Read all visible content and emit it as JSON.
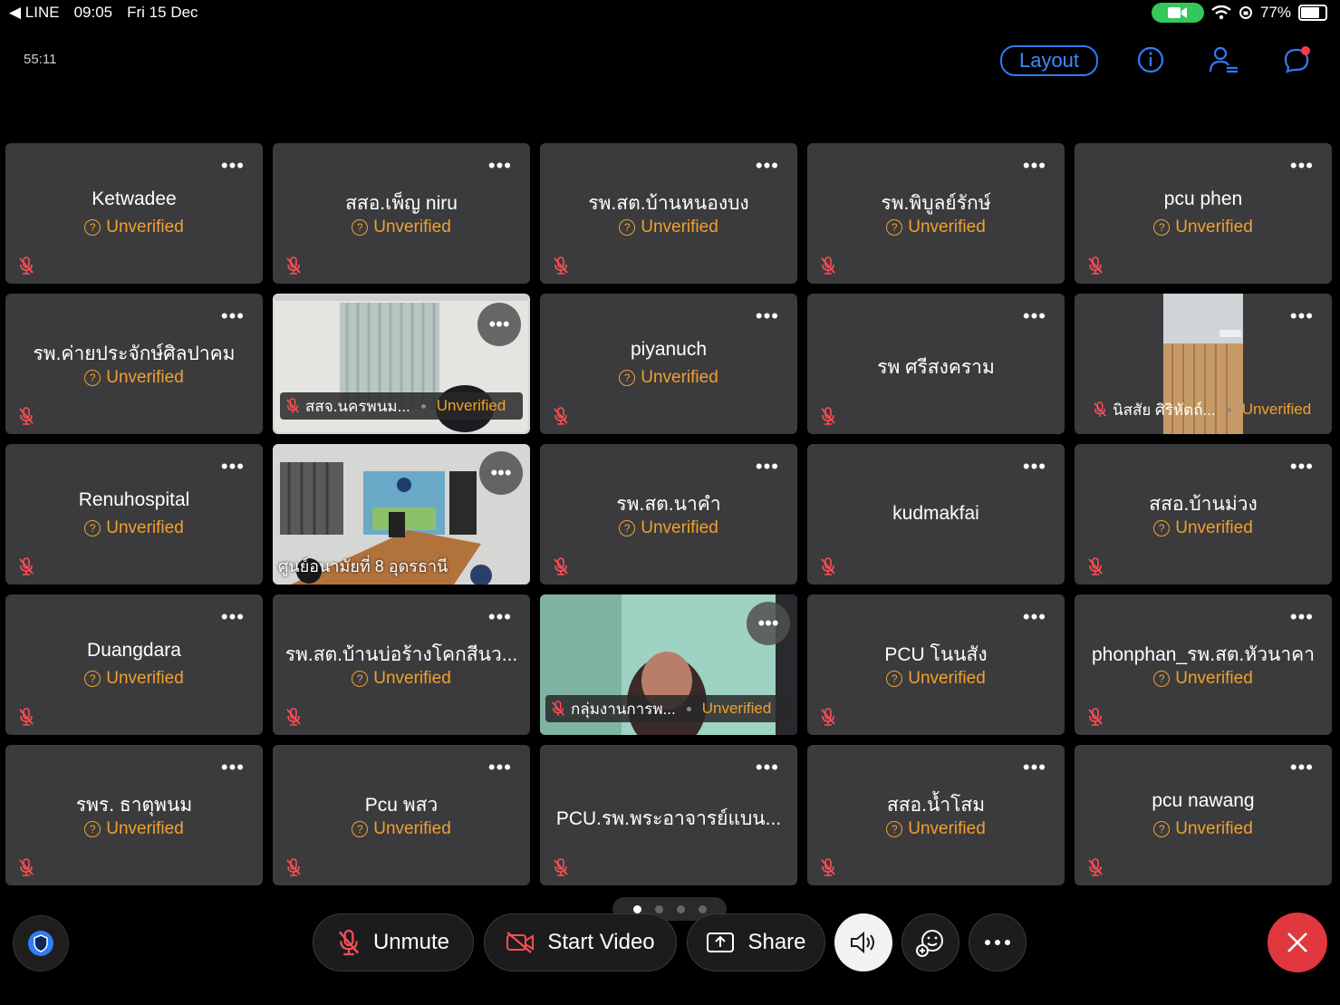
{
  "statusbar": {
    "back_app": "◀ LINE",
    "time": "09:05",
    "date": "Fri 15 Dec",
    "battery": "77%"
  },
  "header": {
    "timer": "55:11",
    "layout_label": "Layout"
  },
  "tiles": [
    {
      "name": "Ketwadee",
      "status": "Unverified"
    },
    {
      "name": "สสอ.เพ็ญ niru",
      "status": "Unverified"
    },
    {
      "name": "รพ.สต.บ้านหนองบง",
      "status": "Unverified"
    },
    {
      "name": "รพ.พิบูลย์รักษ์",
      "status": "Unverified"
    },
    {
      "name": "pcu phen",
      "status": "Unverified"
    },
    {
      "name": "รพ.ค่ายประจักษ์ศิลปาคม",
      "status": "Unverified"
    },
    {
      "name": "สสจ.นครพนม...",
      "status": "Unverified"
    },
    {
      "name": "piyanuch",
      "status": "Unverified"
    },
    {
      "name": "รพ ศรีสงคราม",
      "status": ""
    },
    {
      "name": "นิสสัย  ศิริหัตถ์...",
      "status": "Unverified"
    },
    {
      "name": "Renuhospital",
      "status": "Unverified"
    },
    {
      "name": "ศูนย์อนามัยที่ 8 อุดรธานี",
      "status": ""
    },
    {
      "name": "รพ.สต.นาคำ",
      "status": "Unverified"
    },
    {
      "name": "kudmakfai",
      "status": ""
    },
    {
      "name": "สสอ.บ้านม่วง",
      "status": "Unverified"
    },
    {
      "name": "Duangdara",
      "status": "Unverified"
    },
    {
      "name": "รพ.สต.บ้านบ่อร้างโคกสีนว...",
      "status": "Unverified"
    },
    {
      "name": "กลุ่มงานการพ...",
      "status": "Unverified"
    },
    {
      "name": "PCU โนนสัง",
      "status": "Unverified"
    },
    {
      "name": "phonphan_รพ.สต.หัวนาคา",
      "status": "Unverified"
    },
    {
      "name": "รพร. ธาตุพนม",
      "status": "Unverified"
    },
    {
      "name": "Pcu พสว",
      "status": "Unverified"
    },
    {
      "name": "PCU.รพ.พระอาจารย์แบน...",
      "status": ""
    },
    {
      "name": "สสอ.น้ำโสม",
      "status": "Unverified"
    },
    {
      "name": "pcu nawang",
      "status": "Unverified"
    }
  ],
  "toolbar": {
    "unmute_label": "Unmute",
    "start_video_label": "Start Video",
    "share_label": "Share"
  },
  "colors": {
    "accent": "#2f7cf6",
    "unverified": "#f0a030",
    "end": "#e0383e",
    "tile": "#3b3b3d"
  }
}
